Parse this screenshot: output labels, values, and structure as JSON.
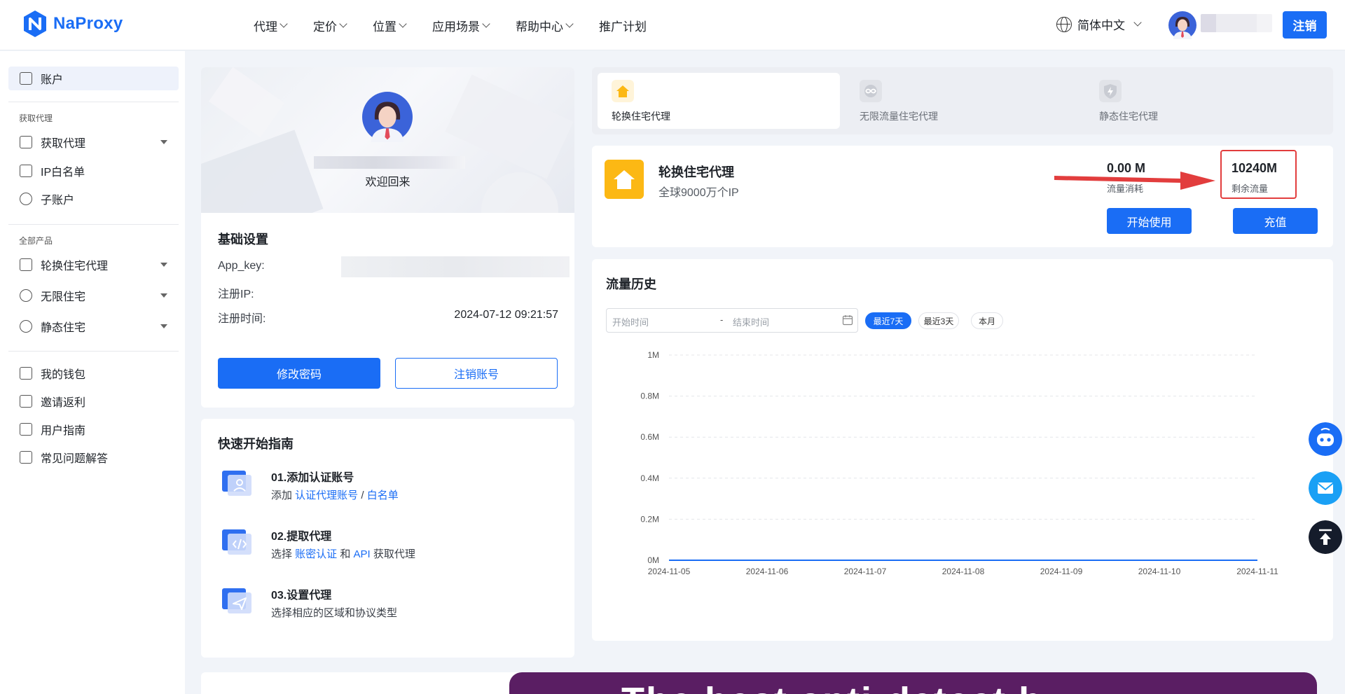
{
  "brand": {
    "name": "NaProxy",
    "color": "#1a6df5"
  },
  "nav": [
    {
      "label": "代理",
      "has_dropdown": true
    },
    {
      "label": "定价",
      "has_dropdown": true
    },
    {
      "label": "位置",
      "has_dropdown": true
    },
    {
      "label": "应用场景",
      "has_dropdown": true
    },
    {
      "label": "帮助中心",
      "has_dropdown": true
    },
    {
      "label": "推广计划",
      "has_dropdown": false
    }
  ],
  "header": {
    "language": "简体中文",
    "logout_label": "注销"
  },
  "sidebar": {
    "account": "账户",
    "section_get_proxy": "获取代理",
    "get_proxy": "获取代理",
    "ip_whitelist": "IP白名单",
    "sub_account": "子账户",
    "section_products": "全部产品",
    "rotating": "轮换住宅代理",
    "unlimited": "无限住宅",
    "static": "静态住宅",
    "wallet": "我的钱包",
    "referral": "邀请返利",
    "guide": "用户指南",
    "faq": "常见问题解答"
  },
  "profile": {
    "welcome": "欢迎回来",
    "settings_title": "基础设置",
    "app_key_label": "App_key:",
    "reg_ip_label": "注册IP:",
    "reg_time_label": "注册时间:",
    "reg_time_value": "2024-07-12 09:21:57",
    "change_password": "修改密码",
    "delete_account": "注销账号"
  },
  "quick_start": {
    "title": "快速开始指南",
    "steps": [
      {
        "title": "01.添加认证账号",
        "pre": "添加 ",
        "link1": "认证代理账号",
        "mid": " / ",
        "link2": "白名单",
        "post": ""
      },
      {
        "title": "02.提取代理",
        "pre": "选择 ",
        "link1": "账密认证",
        "mid": " 和 ",
        "link2": "API",
        "post": " 获取代理"
      },
      {
        "title": "03.设置代理",
        "desc": "选择相应的区域和协议类型"
      }
    ]
  },
  "product_tabs": [
    {
      "label": "轮换住宅代理",
      "active": true
    },
    {
      "label": "无限流量住宅代理",
      "active": false
    },
    {
      "label": "静态住宅代理",
      "active": false
    }
  ],
  "product": {
    "title": "轮换住宅代理",
    "subtitle": "全球9000万个IP",
    "used_value": "0.00 M",
    "used_label": "流量消耗",
    "remaining_value": "10240M",
    "remaining_label": "剩余流量",
    "start_button": "开始使用",
    "recharge_button": "充值"
  },
  "history": {
    "title": "流量历史",
    "start_placeholder": "开始时间",
    "separator": "-",
    "end_placeholder": "结束时间",
    "chips": [
      {
        "label": "最近7天",
        "active": true
      },
      {
        "label": "最近3天",
        "active": false
      },
      {
        "label": "本月",
        "active": false
      }
    ]
  },
  "chart_data": {
    "type": "line",
    "x": [
      "2024-11-05",
      "2024-11-06",
      "2024-11-07",
      "2024-11-08",
      "2024-11-09",
      "2024-11-10",
      "2024-11-11"
    ],
    "series": [
      {
        "values": [
          0,
          0,
          0,
          0,
          0,
          0,
          0
        ]
      }
    ],
    "yticks": [
      "0M",
      "0.2M",
      "0.4M",
      "0.6M",
      "0.8M",
      "1M"
    ],
    "ylim": [
      0,
      1
    ],
    "grid": true,
    "color": "#1a6df5"
  },
  "promo": {
    "text": "The best anti-detect b"
  },
  "colors": {
    "accent": "#1a6df5",
    "highlight": "#e23d3d",
    "product_icon": "#fcb814"
  }
}
